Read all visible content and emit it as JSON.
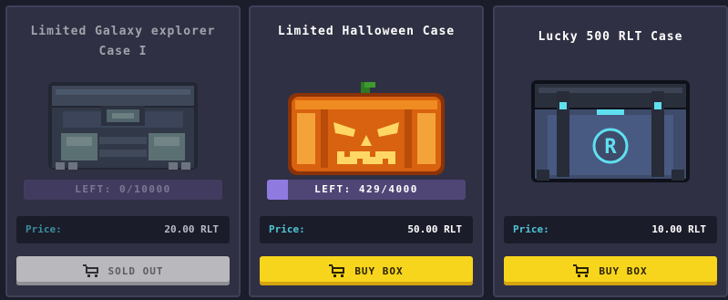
{
  "cards": [
    {
      "title": "Limited Galaxy explorer Case I",
      "left_text": "LEFT: 0/10000",
      "left_fraction": 0,
      "price_label": "Price:",
      "price_value": "20.00 RLT",
      "action_label": "SOLD OUT",
      "action_icon": "cart-icon",
      "art_icon": "galaxy-chest-icon",
      "status": "sold-out"
    },
    {
      "title": "Limited Halloween Case",
      "left_text": "LEFT: 429/4000",
      "left_fraction": 0.1073,
      "price_label": "Price:",
      "price_value": "50.00 RLT",
      "action_label": "BUY BOX",
      "action_icon": "cart-icon",
      "art_icon": "pumpkin-chest-icon",
      "status": "available"
    },
    {
      "title": "Lucky 500 RLT Case",
      "price_label": "Price:",
      "price_value": "10.00 RLT",
      "action_label": "BUY BOX",
      "action_icon": "cart-icon",
      "art_icon": "lucky-chest-icon",
      "status": "available"
    }
  ],
  "colors": {
    "background": "#1c1d2b",
    "card": "#2f3043",
    "price_label": "#4fc7d9",
    "buy_button": "#f7d51d",
    "sold_button": "#b9b9bd",
    "left_bar": "#504676",
    "left_fill": "#8f7ae0"
  }
}
